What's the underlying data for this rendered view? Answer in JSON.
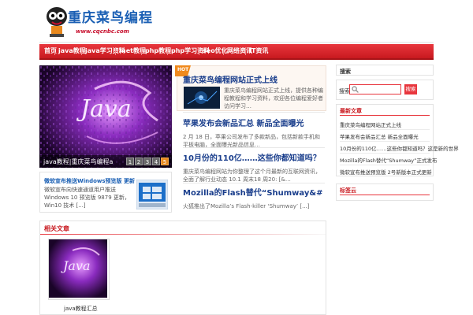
{
  "header": {
    "logo_title": "重庆菜鸟编程",
    "logo_url": "www.cqcnbc.com",
    "brand_red": "#e8363d",
    "brand_blue": "#1a5fb4"
  },
  "nav": {
    "items": [
      {
        "label": "首页"
      },
      {
        "label": "java教程"
      },
      {
        "label": "java学习资料"
      },
      {
        "label": ".net教程"
      },
      {
        "label": "php教程"
      },
      {
        "label": "php学习资料"
      },
      {
        "label": "seo优化"
      },
      {
        "label": "网络资讯"
      },
      {
        "label": "IT资讯"
      }
    ]
  },
  "slider": {
    "image_text": "Java",
    "caption": "java教程|重庆菜鸟编程a",
    "dots": [
      "1",
      "2",
      "3",
      "4",
      "5"
    ],
    "active_dot": "5"
  },
  "featured_small": {
    "title": "微软宣布推送Windows预览版 更新",
    "desc": "微软宣布向快速通道用户推送 Windows 10 预览版 9879 更新，Win10 技术 [...]"
  },
  "hot_badge": "HOT",
  "articles": [
    {
      "title": "重庆菜鸟编程网站正式上线",
      "desc": "重庆菜鸟编程网站正式上线，提供各种编程教程和学习资料，欢迎各位编程爱好者访问学习…"
    },
    {
      "title": "苹果发布会新品汇总 新品全面曝光",
      "desc": "2 月 18 日，苹果公司发布了多款新品，包括新款手机和平板电脑，全面曝光新品信息…"
    },
    {
      "title": "10月份的110亿……这些你都知道吗？",
      "desc": "重庆菜鸟编程网站为你整理了这个月最新的互联网资讯，全面了解行业动态 10.1 周末18 周20: [&…"
    },
    {
      "title": "Mozilla的Flash替代“Shumway&#",
      "desc": "火狐推出了Mozilla’s Flash-killer ‘Shumway’ [...]"
    }
  ],
  "sidebar": {
    "search": {
      "label": "搜索",
      "button": "搜索",
      "placeholder": ""
    },
    "latest": {
      "title": "最新文章",
      "items": [
        "重庆菜鸟编程网站正式上线",
        "苹果发布会新品汇总 新品全面曝光",
        "10月份的110亿……这些你都知道吗？这是新的世界",
        "Mozilla的Flash替代“Shumway”正式发布",
        "微软宣布推送预览版 2号新版本正式更新"
      ]
    },
    "tags": {
      "title": "标签云"
    }
  },
  "related": {
    "title": "相关文章",
    "thumb_text": "Java",
    "caption": "java教程汇总"
  }
}
